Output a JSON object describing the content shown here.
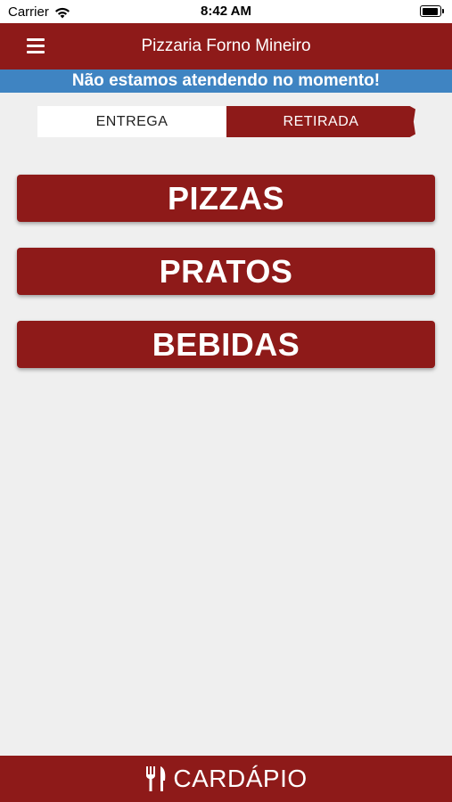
{
  "status_bar": {
    "carrier": "Carrier",
    "time": "8:42 AM"
  },
  "header": {
    "title": "Pizzaria Forno Mineiro",
    "menu_icon": "hamburger-menu-icon"
  },
  "notice": {
    "text": "Não estamos atendendo no momento!",
    "color": "#3f84c2"
  },
  "order_type": {
    "options": [
      "ENTREGA",
      "RETIRADA"
    ],
    "selected": "RETIRADA"
  },
  "categories": [
    {
      "label": "PIZZAS"
    },
    {
      "label": "PRATOS"
    },
    {
      "label": "BEBIDAS"
    }
  ],
  "bottom_bar": {
    "label": "CARDÁPIO",
    "icon": "cutlery-icon"
  },
  "colors": {
    "brand": "#8e1a19",
    "background": "#efefef",
    "notice": "#3f84c2"
  }
}
